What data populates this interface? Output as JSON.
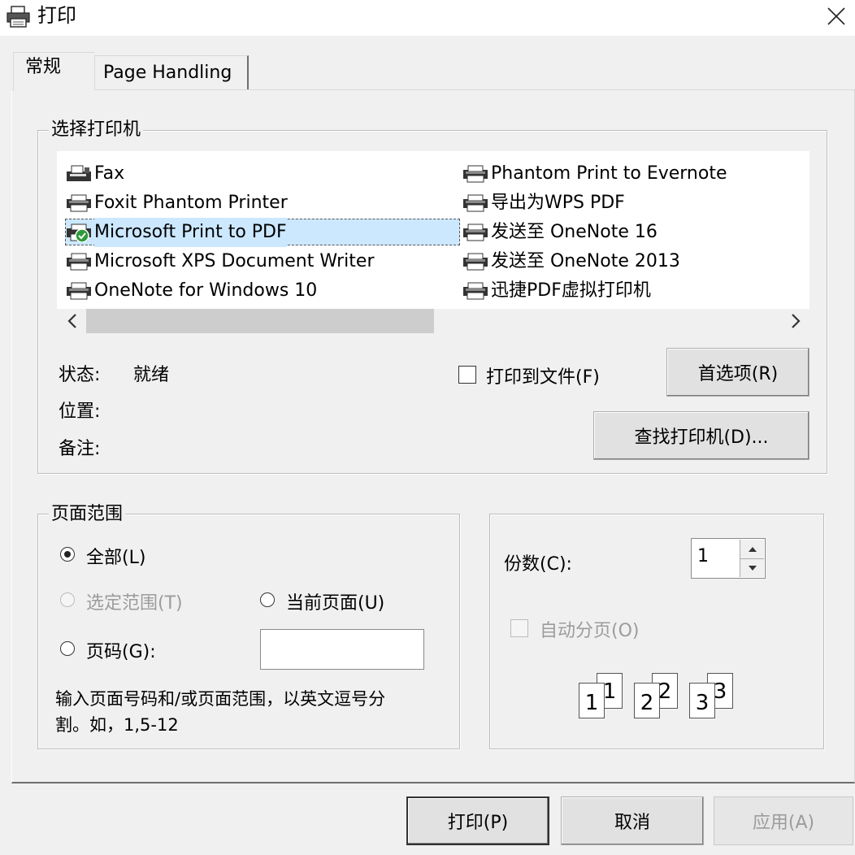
{
  "window": {
    "title": "打印",
    "close_icon": "close-icon",
    "print_icon": "printer-icon"
  },
  "tabs": [
    {
      "label": "常规",
      "active": true
    },
    {
      "label": "Page Handling",
      "active": false
    }
  ],
  "select_printer": {
    "legend": "选择打印机",
    "printers_left": [
      {
        "name": "Fax",
        "icon": "fax-icon"
      },
      {
        "name": "Foxit Phantom Printer",
        "icon": "printer-icon"
      },
      {
        "name": "Microsoft Print to PDF",
        "icon": "default-printer-icon",
        "selected": true
      },
      {
        "name": "Microsoft XPS Document Writer",
        "icon": "printer-icon"
      },
      {
        "name": "OneNote for Windows 10",
        "icon": "printer-icon"
      }
    ],
    "printers_right": [
      {
        "name": "Phantom Print to Evernote",
        "icon": "printer-icon"
      },
      {
        "name": "导出为WPS PDF",
        "icon": "printer-icon"
      },
      {
        "name": "发送至 OneNote 16",
        "icon": "printer-icon"
      },
      {
        "name": "发送至 OneNote 2013",
        "icon": "printer-icon"
      },
      {
        "name": "迅捷PDF虚拟打印机",
        "icon": "printer-icon"
      }
    ],
    "status_label": "状态:",
    "status_value": "就绪",
    "location_label": "位置:",
    "comment_label": "备注:",
    "print_to_file": {
      "label": "打印到文件(F)",
      "checked": false
    },
    "preferences_button": "首选项(R)",
    "find_printer_button": "查找打印机(D)..."
  },
  "page_range": {
    "legend": "页面范围",
    "all": "全部(L)",
    "selection": "选定范围(T)",
    "current_page": "当前页面(U)",
    "pages": "页码(G):",
    "pages_value": "",
    "hint_line1": "输入页面号码和/或页面范围，以英文逗号分",
    "hint_line2": "割。如，1,5-12",
    "selected_option": "all"
  },
  "copies": {
    "label": "份数(C):",
    "value": "1",
    "collate": {
      "label": "自动分页(O)",
      "checked": false,
      "disabled": true
    },
    "collate_pages": [
      "1",
      "1",
      "2",
      "2",
      "3",
      "3"
    ]
  },
  "footer": {
    "print_button": "打印(P)",
    "cancel_button": "取消",
    "apply_button": "应用(A)"
  }
}
